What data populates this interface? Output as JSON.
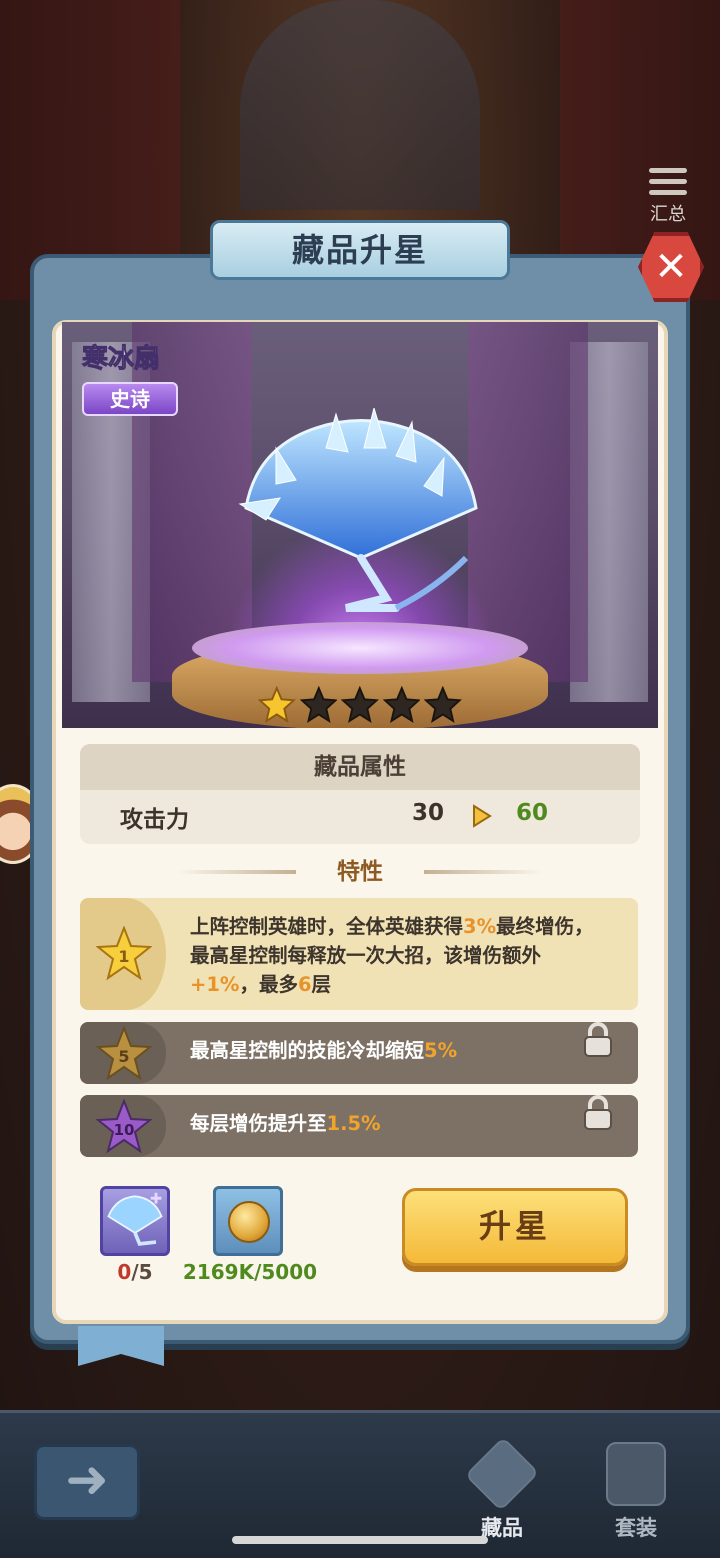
{
  "background": {
    "summary_label": "汇总"
  },
  "dialog": {
    "title": "藏品升星",
    "close_icon": "close-icon"
  },
  "item": {
    "name": "寒冰扇",
    "rarity": "史诗",
    "stars_filled": 1,
    "stars_total": 5
  },
  "attributes": {
    "header": "藏品属性",
    "rows": [
      {
        "label": "攻击力",
        "current": "30",
        "next": "60"
      }
    ]
  },
  "traits": {
    "header": "特性",
    "items": [
      {
        "level": "1",
        "locked": false,
        "segments": [
          "上阵控制英雄时，全体英雄获得",
          "3%",
          "最终增伤，最高星控制每释放一次大招，该增伤额外",
          "+1%",
          "，最多",
          "6",
          "层"
        ]
      },
      {
        "level": "5",
        "locked": true,
        "segments": [
          "最高星控制的技能冷却缩短",
          "5%"
        ]
      },
      {
        "level": "10",
        "locked": true,
        "segments": [
          "每层增伤提升至",
          "1.5%"
        ]
      }
    ]
  },
  "costs": {
    "shard": {
      "have": "0",
      "sep_need": "/5"
    },
    "coin": {
      "text": "2169K/5000"
    }
  },
  "upgrade_button": "升星",
  "nav": {
    "back_icon": "back-arrow-icon",
    "items": [
      {
        "label": "藏品",
        "active": true
      },
      {
        "label": "套装",
        "active": false
      }
    ]
  },
  "colors": {
    "highlight": "#f2a42a",
    "stat_up": "#4f8a1e",
    "cost_insufficient": "#c0392b",
    "button_gold": "#f4b938",
    "rarity_purple": "#7a46c6"
  }
}
